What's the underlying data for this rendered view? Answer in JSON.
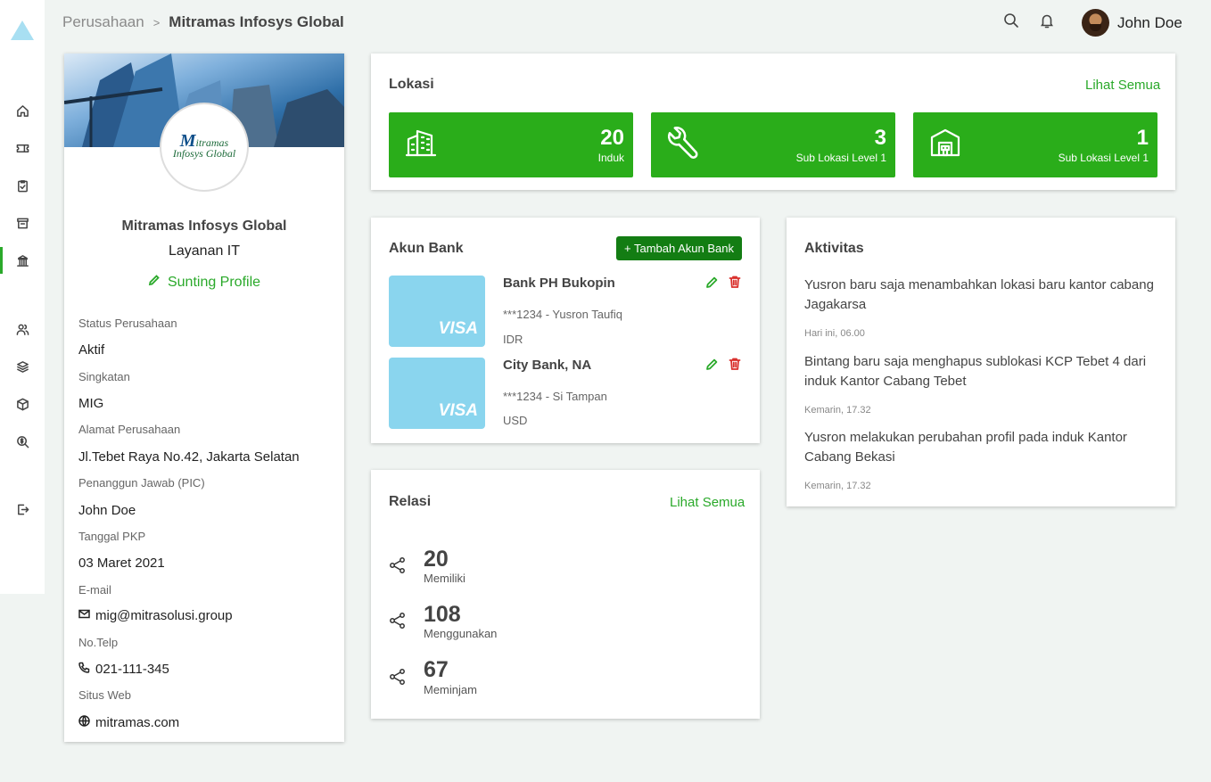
{
  "sidebar": {
    "items": [
      {
        "name": "home-icon"
      },
      {
        "name": "ticket-icon"
      },
      {
        "name": "clipboard-check-icon"
      },
      {
        "name": "archive-icon"
      },
      {
        "name": "bank-icon",
        "active": true
      },
      {
        "name": "users-icon"
      },
      {
        "name": "layers-icon"
      },
      {
        "name": "cube-icon"
      },
      {
        "name": "search-dollar-icon"
      },
      {
        "name": "logout-icon"
      }
    ]
  },
  "header": {
    "breadcrumb_parent": "Perusahaan",
    "breadcrumb_sep": ">",
    "breadcrumb_current": "Mitramas Infosys Global",
    "user_name": "John Doe"
  },
  "profile": {
    "logo_text_1": "itramas",
    "logo_text_2": "Infosys Global",
    "name": "Mitramas Infosys Global",
    "service": "Layanan IT",
    "edit_label": "Sunting Profile",
    "fields": [
      {
        "label": "Status Perusahaan",
        "value": "Aktif"
      },
      {
        "label": "Singkatan",
        "value": "MIG"
      },
      {
        "label": "Alamat Perusahaan",
        "value": "Jl.Tebet Raya No.42, Jakarta Selatan"
      },
      {
        "label": "Penanggun Jawab (PIC)",
        "value": "John Doe"
      },
      {
        "label": "Tanggal PKP",
        "value": "03 Maret 2021"
      },
      {
        "label": "E-mail",
        "value": "mig@mitrasolusi.group",
        "icon": "mail-icon"
      },
      {
        "label": "No.Telp",
        "value": "021-111-345",
        "icon": "phone-icon"
      },
      {
        "label": "Situs Web",
        "value": "mitramas.com",
        "icon": "globe-icon"
      }
    ]
  },
  "lokasi": {
    "title": "Lokasi",
    "see_all": "Lihat Semua",
    "tiles": [
      {
        "value": "20",
        "label": "Induk",
        "icon": "building-icon"
      },
      {
        "value": "3",
        "label": "Sub Lokasi Level 1",
        "icon": "wrench-icon"
      },
      {
        "value": "1",
        "label": "Sub Lokasi Level 1",
        "icon": "warehouse-icon"
      }
    ]
  },
  "bank": {
    "title": "Akun Bank",
    "add_label": "+ Tambah Akun Bank",
    "accounts": [
      {
        "name": "Bank PH Bukopin",
        "account": "***1234 - Yusron Taufiq",
        "currency": "IDR",
        "brand": "VISA"
      },
      {
        "name": "City Bank, NA",
        "account": "***1234 - Si Tampan",
        "currency": "USD",
        "brand": "VISA"
      }
    ]
  },
  "relasi": {
    "title": "Relasi",
    "see_all": "Lihat Semua",
    "items": [
      {
        "value": "20",
        "label": "Memiliki"
      },
      {
        "value": "108",
        "label": "Menggunakan"
      },
      {
        "value": "67",
        "label": "Meminjam"
      }
    ]
  },
  "aktivitas": {
    "title": "Aktivitas",
    "items": [
      {
        "text": "Yusron baru saja menambahkan lokasi baru kantor cabang Jagakarsa",
        "time": "Hari ini, 06.00"
      },
      {
        "text": "Bintang baru saja menghapus sublokasi KCP Tebet 4 dari induk Kantor Cabang Tebet",
        "time": "Kemarin, 17.32"
      },
      {
        "text": "Yusron melakukan perubahan profil pada induk Kantor Cabang Bekasi",
        "time": "Kemarin, 17.32"
      }
    ]
  },
  "colors": {
    "accent": "#2aa92a",
    "tile": "#2aad1a",
    "button": "#137d13",
    "card_visa": "#8ad5ee",
    "delete": "#d9302c"
  }
}
